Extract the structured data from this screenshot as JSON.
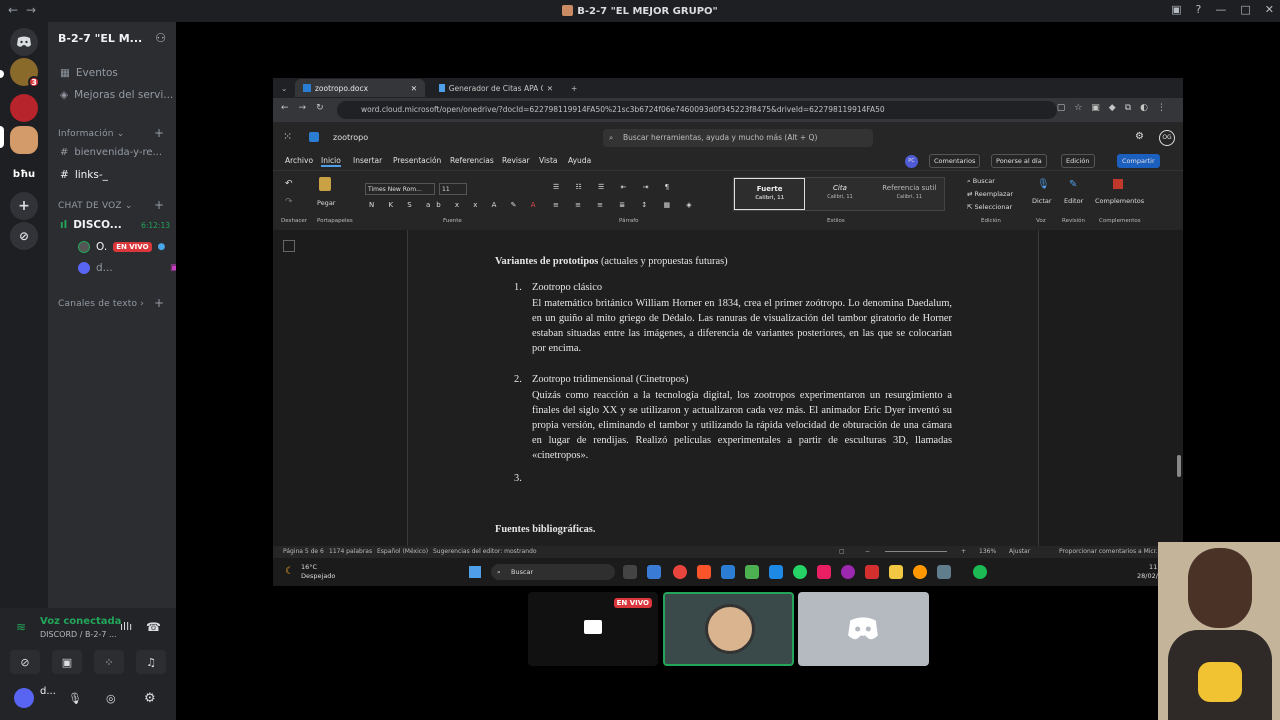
{
  "window": {
    "title": "B-2-7 \"EL MEJOR GRUPO\""
  },
  "server": {
    "name": "B-2-7 \"EL M...",
    "server_badge": "3"
  },
  "rail": {
    "text_server": "bħu"
  },
  "sidebar": {
    "events": "Eventos",
    "boosts": "Mejoras del servi...",
    "info_category": "Información",
    "channels": [
      "bienvenida-y-re...",
      "links-_"
    ],
    "voice_category": "CHAT DE VOZ",
    "voice_channel": {
      "name": "DISCO...",
      "timer": "6:12:13"
    },
    "voice_users": [
      {
        "name": "O.",
        "live": "EN VIVO"
      },
      {
        "name": "d..."
      }
    ],
    "text_category": "Canales de texto"
  },
  "voice_panel": {
    "status": "Voz conectada",
    "sub": "DISCORD / B-2-7 ...",
    "username": "d..."
  },
  "browser": {
    "tabs": [
      {
        "label": "zootropo.docx"
      },
      {
        "label": "Generador de Citas APA Gratui..."
      }
    ],
    "url": "word.cloud.microsoft/open/onedrive/?docId=622798119914FA50%21sc3b6724f06e7460093d0f345223f8475&driveId=622798119914FA50"
  },
  "word": {
    "doc_name": "zootropo",
    "search_placeholder": "Buscar herramientas, ayuda y mucho más (Alt + Q)",
    "user_initials": "OG",
    "pc_initials": "PC",
    "menu": [
      "Archivo",
      "Inicio",
      "Insertar",
      "Presentación",
      "Referencias",
      "Revisar",
      "Vista",
      "Ayuda"
    ],
    "right_buttons": {
      "comments": "Comentarios",
      "catchup": "Ponerse al día",
      "editing": "Edición",
      "share": "Compartir"
    },
    "ribbon": {
      "undo": "Deshacer",
      "paste": "Pegar",
      "clipboard": "Portapapeles",
      "font_name": "Times New Rom...",
      "font_size": "11",
      "font_group": "Fuente",
      "paragraph_group": "Párrafo",
      "styles": [
        {
          "name": "Fuerte",
          "sub": "Calibri, 11"
        },
        {
          "name": "Cita",
          "sub": "Calibri, 11"
        },
        {
          "name": "Referencia sutil",
          "sub": "Calibri, 11"
        }
      ],
      "styles_group": "Estilos",
      "find": "Buscar",
      "replace": "Reemplazar",
      "select": "Seleccionar",
      "editing_group": "Edición",
      "dictate": "Dictar",
      "voice_group": "Voz",
      "editor": "Editor",
      "review_group": "Revisión",
      "addins": "Complementos",
      "addins_group": "Complementos"
    },
    "document": {
      "heading_bold": "Variantes de prototipos",
      "heading_rest": " (actuales y propuestas futuras)",
      "items": [
        {
          "num": "1.",
          "title": "Zootropo clásico",
          "body": "El matemático británico William Horner en 1834, crea el primer zoótropo. Lo denomina Daedalum, en un guiño al mito griego de Dédalo. Las ranuras de visualización del tambor giratorio de Horner estaban situadas entre las imágenes, a diferencia de variantes posteriores, en las que se colocarían por encima."
        },
        {
          "num": "2.",
          "title": "Zootropo tridimensional (Cinetropos)",
          "body": "Quizás como reacción a la tecnología digital, los zootropos experimentaron un resurgimiento a finales del siglo XX y se utilizaron y actualizaron cada vez más. El animador Eric Dyer inventó su propia versión, eliminando el tambor y utilizando la rápida velocidad de obturación de una cámara en lugar de rendijas. Realizó películas experimentales a partir de esculturas 3D, llamadas «cinetropos»."
        },
        {
          "num": "3.",
          "title": "",
          "body": ""
        }
      ],
      "sources_heading": "Fuentes bibliográficas."
    },
    "status": {
      "page": "Página 5 de 6",
      "words": "1174 palabras",
      "lang": "Español (México)",
      "editor": "Sugerencias del editor: mostrando",
      "zoom": "136%",
      "fit": "Ajustar",
      "feedback": "Proporcionar comentarios a Micr..."
    }
  },
  "taskbar": {
    "temp": "16°C",
    "weather": "Despejado",
    "search": "Buscar",
    "time": "11:35 p.",
    "date": "28/02/2"
  },
  "stream": {
    "live_label": "EN VIVO"
  },
  "colors": {
    "accent": "#4f9eea",
    "live": "#da373c",
    "voice_green": "#23a55a",
    "discord_blurple": "#5865f2"
  }
}
